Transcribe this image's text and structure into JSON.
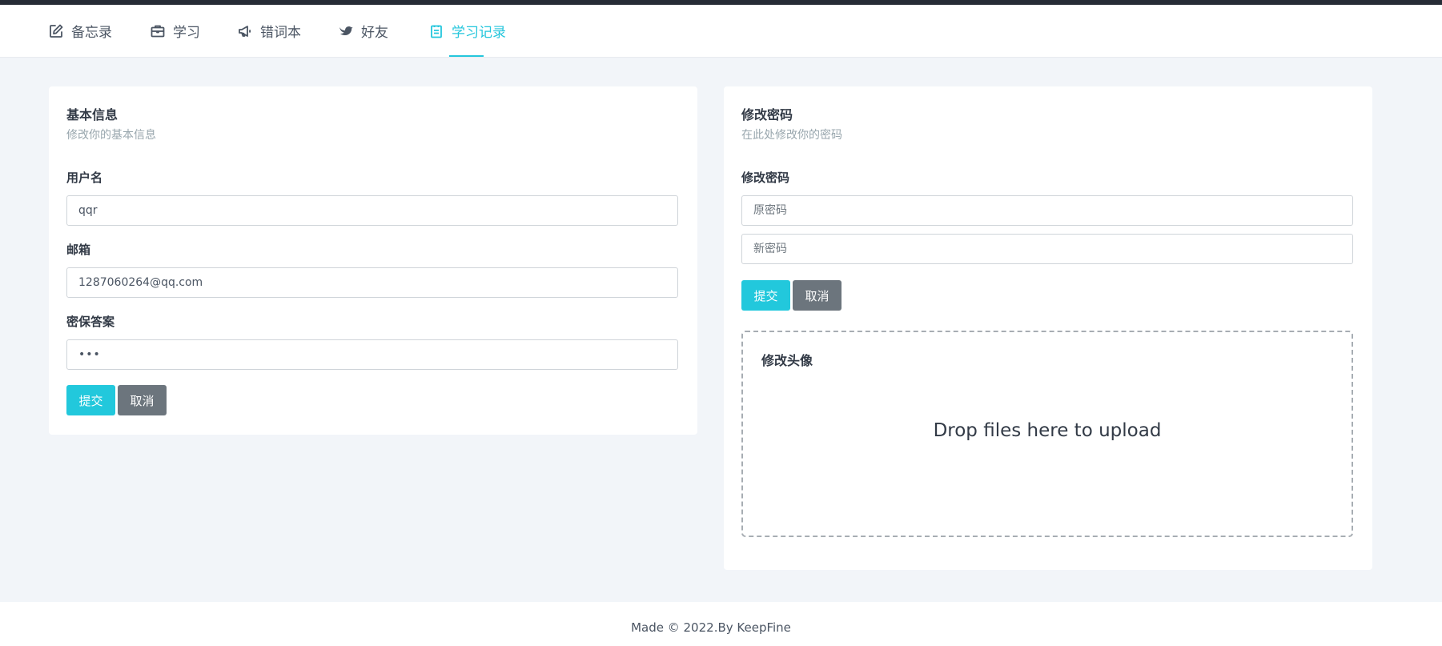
{
  "nav": {
    "items": [
      {
        "label": "备忘录",
        "icon": "edit-icon"
      },
      {
        "label": "学习",
        "icon": "briefcase-icon"
      },
      {
        "label": "错词本",
        "icon": "megaphone-icon"
      },
      {
        "label": "好友",
        "icon": "bird-icon"
      },
      {
        "label": "学习记录",
        "icon": "clipboard-icon",
        "active": true
      }
    ]
  },
  "basic_info": {
    "title": "基本信息",
    "subtitle": "修改你的基本信息",
    "username_label": "用户名",
    "username_value": "qqr",
    "email_label": "邮箱",
    "email_value": "1287060264@qq.com",
    "security_label": "密保答案",
    "security_value": "•••",
    "submit_label": "提交",
    "cancel_label": "取消"
  },
  "password": {
    "title": "修改密码",
    "subtitle": "在此处修改你的密码",
    "section_label": "修改密码",
    "old_placeholder": "原密码",
    "new_placeholder": "新密码",
    "submit_label": "提交",
    "cancel_label": "取消"
  },
  "avatar": {
    "title": "修改头像",
    "drop_message": "Drop files here to upload"
  },
  "footer": {
    "text": "Made © 2022.By KeepFine"
  },
  "colors": {
    "accent": "#24c6dc",
    "secondary_button": "#6c757d",
    "top_strip": "#262c36",
    "page_background": "#f2f5f9"
  }
}
